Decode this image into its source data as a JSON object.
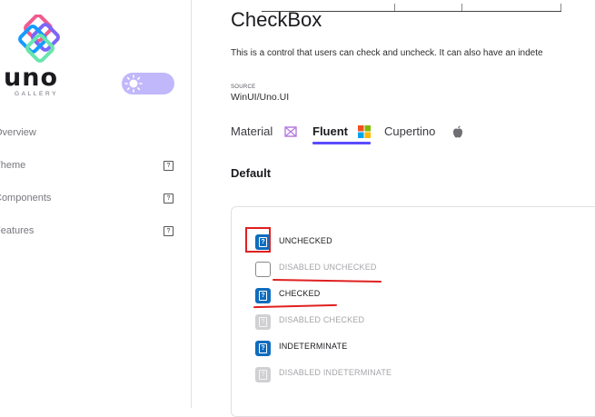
{
  "sidebar": {
    "logo_text": "uno",
    "logo_subtext": "GALLERY",
    "items": [
      {
        "label": "Overview"
      },
      {
        "label": "Theme"
      },
      {
        "label": "Components"
      },
      {
        "label": "Features"
      }
    ],
    "theme_toggle": {
      "icon": "sun-icon",
      "color": "#c1b7fb"
    }
  },
  "page": {
    "title": "CheckBox",
    "description": "This is a control that users can check and uncheck. It can also have an indete",
    "source_label": "SOURCE",
    "source_value": "WinUI/Uno.UI"
  },
  "tabs": [
    {
      "label": "Material",
      "icon": "material-logo-icon",
      "active": false
    },
    {
      "label": "Fluent",
      "icon": "windows-logo-icon",
      "active": true
    },
    {
      "label": "Cupertino",
      "icon": "apple-logo-icon",
      "active": false
    }
  ],
  "section": {
    "title": "Default"
  },
  "checkboxes": [
    {
      "label": "UNCHECKED",
      "state": "placeholder-icon",
      "disabled": false
    },
    {
      "label": "DISABLED UNCHECKED",
      "state": "unchecked",
      "disabled": true
    },
    {
      "label": "CHECKED",
      "state": "placeholder-icon",
      "disabled": false
    },
    {
      "label": "DISABLED CHECKED",
      "state": "placeholder-icon",
      "disabled": true
    },
    {
      "label": "INDETERMINATE",
      "state": "placeholder-icon",
      "disabled": false
    },
    {
      "label": "DISABLED INDETERMINATE",
      "state": "placeholder-icon",
      "disabled": true
    }
  ],
  "placeholder_glyph": "?",
  "colors": {
    "accent": "#5b4cff",
    "checkbox_blue": "#0f6cbd",
    "annotation_red": "#e02020"
  }
}
